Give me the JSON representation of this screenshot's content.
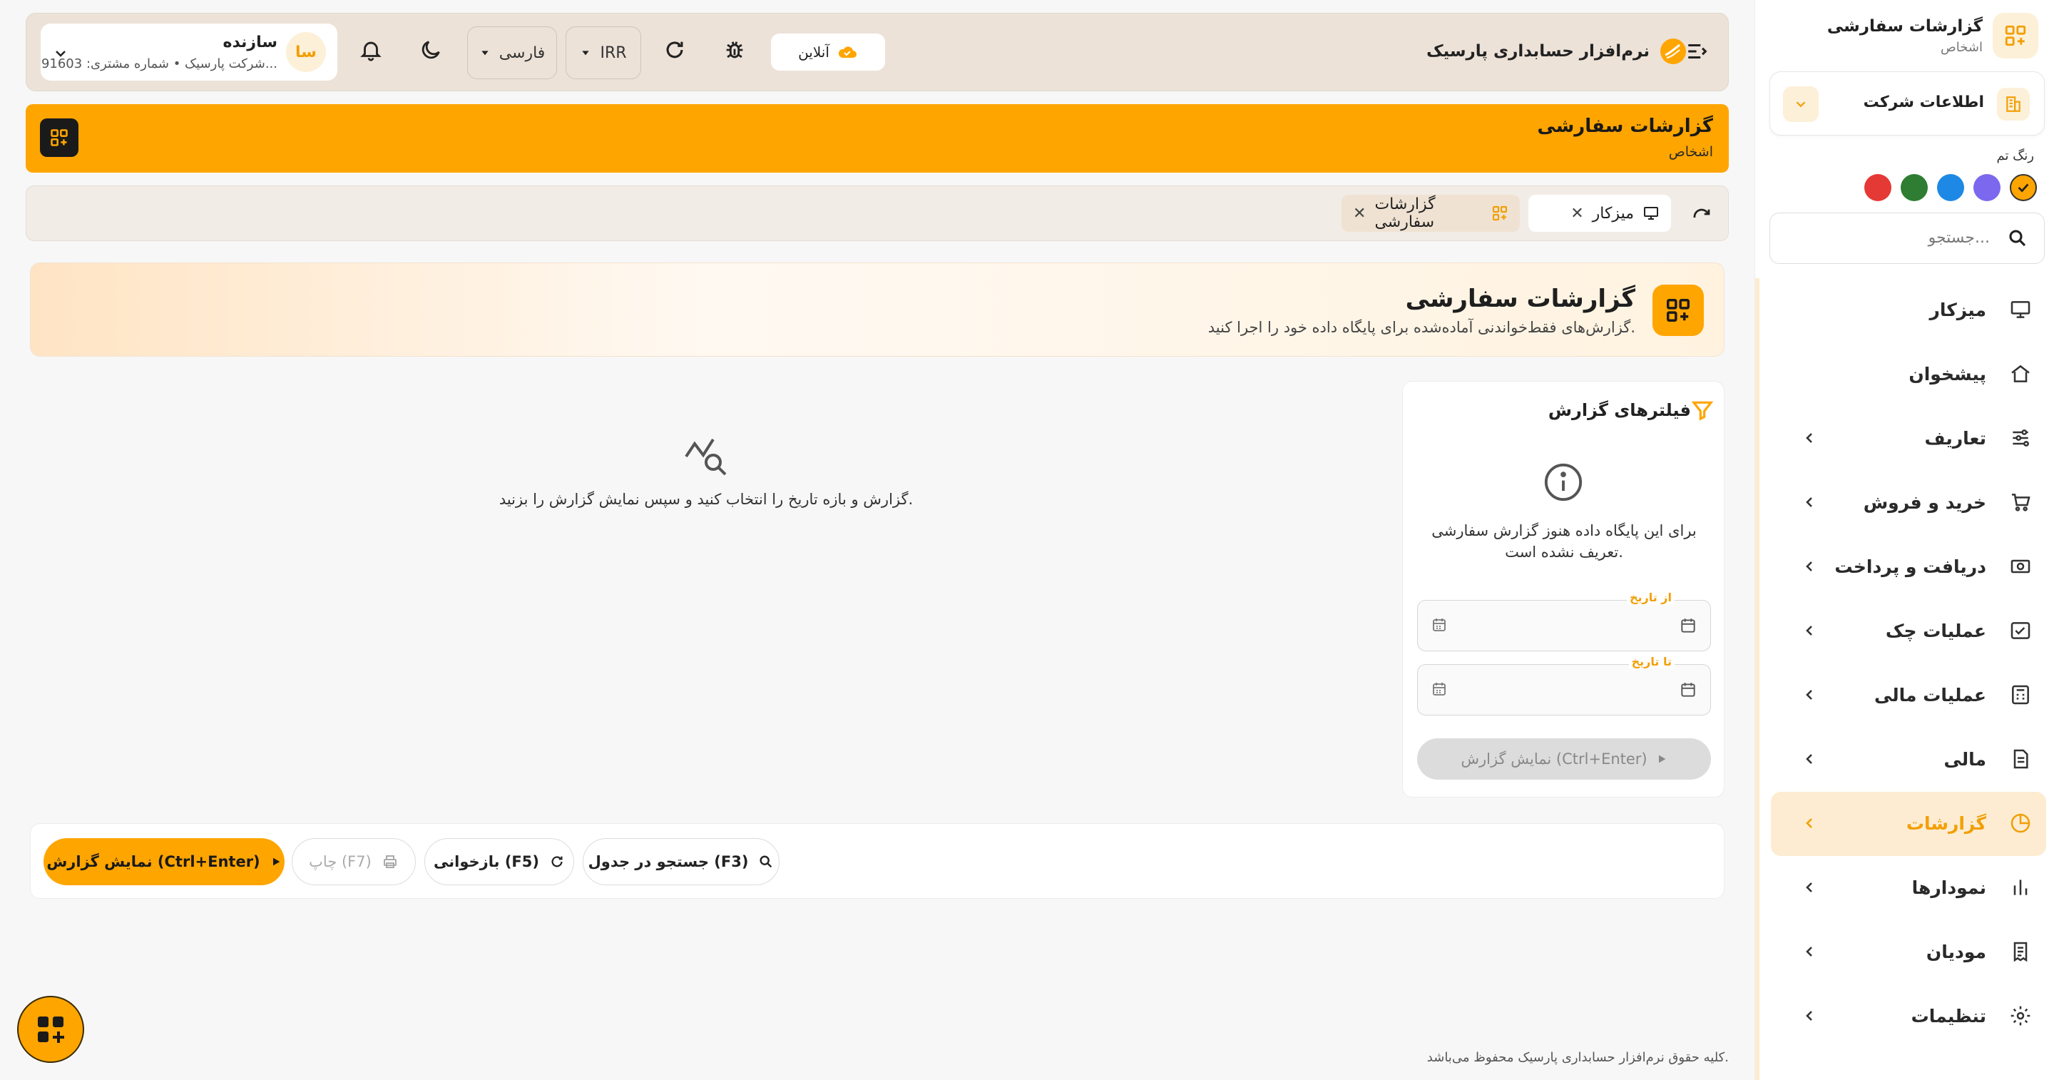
{
  "sidebar": {
    "header_title": "گزارشات سفارشی",
    "header_subtitle": "اشخاص",
    "company_label": "اطلاعات شرکت",
    "theme_label": "رنگ تم",
    "theme_colors": [
      "#ffa500",
      "#7b68ee",
      "#1e88e5",
      "#2e7d32",
      "#e53935"
    ],
    "search_placeholder": "جستجو...",
    "items": [
      {
        "label": "میزکار",
        "icon": "monitor-icon",
        "has_children": false,
        "active": false
      },
      {
        "label": "پیشخوان",
        "icon": "home-icon",
        "has_children": false,
        "active": false
      },
      {
        "label": "تعاریف",
        "icon": "sliders-icon",
        "has_children": true,
        "active": false
      },
      {
        "label": "خرید و فروش",
        "icon": "cart-icon",
        "has_children": true,
        "active": false
      },
      {
        "label": "دریافت و پرداخت",
        "icon": "cash-icon",
        "has_children": true,
        "active": false
      },
      {
        "label": "عملیات چک",
        "icon": "check-box-icon",
        "has_children": true,
        "active": false
      },
      {
        "label": "عملیات مالی",
        "icon": "calculator-icon",
        "has_children": true,
        "active": false
      },
      {
        "label": "مالی",
        "icon": "document-icon",
        "has_children": true,
        "active": false
      },
      {
        "label": "گزارشات",
        "icon": "pie-chart-icon",
        "has_children": true,
        "active": true
      },
      {
        "label": "نمودارها",
        "icon": "bar-chart-icon",
        "has_children": true,
        "active": false
      },
      {
        "label": "مودیان",
        "icon": "receipt-icon",
        "has_children": true,
        "active": false
      },
      {
        "label": "تنظیمات",
        "icon": "gear-icon",
        "has_children": true,
        "active": false
      }
    ]
  },
  "topbar": {
    "app_title": "نرم‌افزار حسابداری پارسیک",
    "online_label": "آنلاین",
    "currency": "IRR",
    "language": "فارسی",
    "user_avatar": "سا",
    "user_name": "سازنده",
    "user_detail": "شرکت پارسیک • شماره مشتری: 91603..."
  },
  "pagebar": {
    "title": "گزارشات سفارشی",
    "subtitle": "اشخاص"
  },
  "tabs": [
    {
      "label": "میزکار",
      "icon": "monitor-icon"
    },
    {
      "label": "گزارشات سفارشی",
      "icon": "grid-plus-icon"
    }
  ],
  "hero": {
    "title": "گزارشات سفارشی",
    "subtitle": "گزارش‌های فقط‌خواندنی آماده‌شده برای پایگاه داده خود را اجرا کنید."
  },
  "filters": {
    "title": "فیلترهای گزارش",
    "info_message": "برای این پایگاه داده هنوز گزارش سفارشی تعریف نشده است.",
    "from_label": "از تاریخ",
    "to_label": "تا تاریخ",
    "show_button": "نمایش گزارش (Ctrl+Enter)"
  },
  "empty_state": {
    "message": "گزارش و بازه تاریخ را انتخاب کنید و سپس نمایش گزارش را بزنید."
  },
  "actions": {
    "show_report": "نمایش گزارش (Ctrl+Enter)",
    "print": "چاپ (F7)",
    "reload": "بازخوانی (F5)",
    "search": "جستجو در جدول (F3)"
  },
  "footer": {
    "copyright": "کلیه حقوق نرم‌افزار حسابداری پارسیک محفوظ می‌باشد."
  }
}
